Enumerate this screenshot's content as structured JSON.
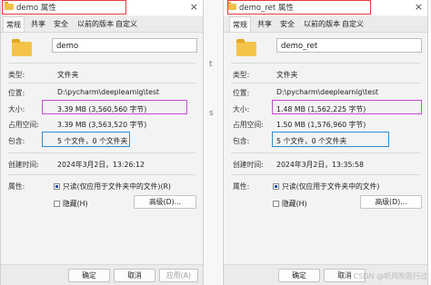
{
  "tabs": [
    "常规",
    "共享",
    "安全",
    "以前的版本",
    "自定义"
  ],
  "labels": {
    "type": "类型:",
    "location": "位置:",
    "size": "大小:",
    "size_on_disk": "占用空间:",
    "contains": "包含:",
    "created": "创建时间:",
    "attributes": "属性:"
  },
  "attributes": {
    "readonly": "只读(仅应用于文件夹中的文件)(R)",
    "readonly_right": "只读(仅应用于文件夹中的文件)",
    "hidden": "隐藏(H)",
    "advanced": "高级(D)..."
  },
  "buttons": {
    "ok": "确定",
    "cancel": "取消",
    "apply": "应用(A)"
  },
  "left": {
    "title": "demo 属性",
    "name": "demo",
    "type": "文件夹",
    "location": "D:\\pycharm\\deeplearnig\\test",
    "size": "3.39 MB (3,560,560 字节)",
    "size_on_disk": "3.39 MB (3,563,520 字节)",
    "contains": "5 个文件，0 个文件夹",
    "created": "2024年3月2日，13:26:12"
  },
  "right": {
    "title": "demo_ret 属性",
    "name": "demo_ret",
    "type": "文件夹",
    "location": "D:\\pycharm\\deeplearnig\\test",
    "size": "1.48 MB (1,562,225 字节)",
    "size_on_disk": "1.50 MB (1,576,960 字节)",
    "contains": "5 个文件，0 个文件夹",
    "created": "2024年3月2日，13:35:58"
  },
  "background_fragments": [
    "t",
    "s"
  ],
  "watermark": "CSDN @听风吹雨行过",
  "colors": {
    "highlight_size": "#c84bd8",
    "highlight_contains": "#2f8fd6",
    "highlight_title": "#e23b3b",
    "folder": "#f3c449"
  },
  "icons": {
    "folder": "folder-icon",
    "close": "close-icon"
  }
}
